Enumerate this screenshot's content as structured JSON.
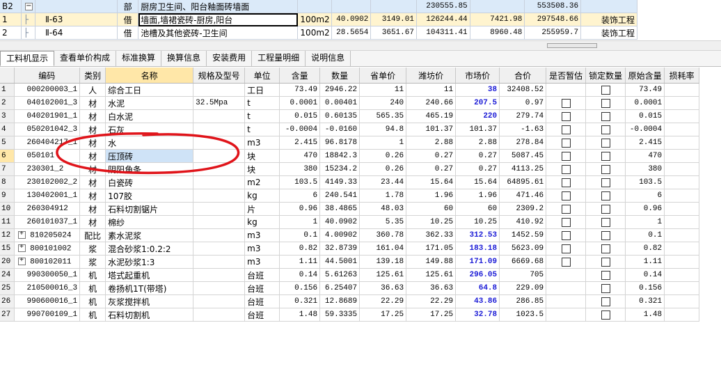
{
  "top_grid": {
    "rows": [
      {
        "no": "B2",
        "expander": "−",
        "code": "",
        "type": "部",
        "name": "厨房卫生间、阳台釉面砖墙面",
        "unit": "",
        "qty": "",
        "price": "",
        "total": "230555.85",
        "c1": "",
        "c2": "553508.36",
        "prof": ""
      },
      {
        "no": "1",
        "expander": "",
        "code": "Ⅱ-63",
        "type": "借",
        "name": "墙面,墙裙瓷砖-厨房,阳台",
        "unit": "100m2",
        "qty": "40.0902",
        "price": "3149.01",
        "total": "126244.44",
        "c1": "7421.98",
        "c2": "297548.66",
        "prof": "装饰工程"
      },
      {
        "no": "2",
        "expander": "",
        "code": "Ⅱ-64",
        "type": "借",
        "name": "池槽及其他瓷砖-卫生间",
        "unit": "100m2",
        "qty": "28.5654",
        "price": "3651.67",
        "total": "104311.41",
        "c1": "8960.48",
        "c2": "255959.7",
        "prof": "装饰工程"
      }
    ]
  },
  "tabs": [
    "工料机显示",
    "查看单价构成",
    "标准换算",
    "换算信息",
    "安装费用",
    "工程量明细",
    "说明信息"
  ],
  "columns": [
    "编码",
    "类别",
    "名称",
    "规格及型号",
    "单位",
    "含量",
    "数量",
    "省单价",
    "潍坊价",
    "市场价",
    "合价",
    "是否暂估",
    "锁定数量",
    "原始含量",
    "损耗率"
  ],
  "rows": [
    {
      "no": "1",
      "plus": false,
      "code": "000200003_1",
      "type": "人",
      "name": "综合工日",
      "spec": "",
      "unit": "工日",
      "content": "73.49",
      "qty": "2946.22",
      "prov": "11",
      "wf": "11",
      "market": "38",
      "total": "32408.52",
      "est": false,
      "lock": true,
      "orig": "73.49"
    },
    {
      "no": "2",
      "plus": false,
      "code": "040102001_3",
      "type": "材",
      "name": "水泥",
      "spec": "32.5Mpa",
      "unit": "t",
      "content": "0.0001",
      "qty": "0.00401",
      "prov": "240",
      "wf": "240.66",
      "market": "207.5",
      "total": "0.97",
      "est": true,
      "lock": true,
      "orig": "0.0001"
    },
    {
      "no": "3",
      "plus": false,
      "code": "040201901_1",
      "type": "材",
      "name": "白水泥",
      "spec": "",
      "unit": "t",
      "content": "0.015",
      "qty": "0.60135",
      "prov": "565.35",
      "wf": "465.19",
      "market": "220",
      "total": "279.74",
      "est": true,
      "lock": true,
      "orig": "0.015"
    },
    {
      "no": "4",
      "plus": false,
      "code": "050201042_3",
      "type": "材",
      "name": "石灰",
      "spec": "",
      "unit": "t",
      "content": "-0.0004",
      "qty": "-0.0160",
      "prov": "94.8",
      "wf": "101.37",
      "market": "101.37",
      "total": "-1.63",
      "est": true,
      "lock": true,
      "orig": "-0.0004"
    },
    {
      "no": "5",
      "plus": false,
      "code": "260404217_1",
      "type": "材",
      "name": "水",
      "spec": "",
      "unit": "m3",
      "content": "2.415",
      "qty": "96.8178",
      "prov": "1",
      "wf": "2.88",
      "market": "2.88",
      "total": "278.84",
      "est": true,
      "lock": true,
      "orig": "2.415"
    },
    {
      "no": "6",
      "plus": false,
      "code": "050101",
      "type": "材",
      "name": "压顶砖",
      "spec": "",
      "unit": "块",
      "content": "470",
      "qty": "18842.3",
      "prov": "0.26",
      "wf": "0.27",
      "market": "0.27",
      "total": "5087.45",
      "est": true,
      "lock": true,
      "orig": "470"
    },
    {
      "no": "7",
      "plus": false,
      "code": "230301_2",
      "type": "材",
      "name": "阴阳角条",
      "spec": "",
      "unit": "块",
      "content": "380",
      "qty": "15234.2",
      "prov": "0.26",
      "wf": "0.27",
      "market": "0.27",
      "total": "4113.25",
      "est": true,
      "lock": true,
      "orig": "380"
    },
    {
      "no": "8",
      "plus": false,
      "code": "230102002_2",
      "type": "材",
      "name": "白瓷砖",
      "spec": "",
      "unit": "m2",
      "content": "103.5",
      "qty": "4149.33",
      "prov": "23.44",
      "wf": "15.64",
      "market": "15.64",
      "total": "64895.61",
      "est": true,
      "lock": true,
      "orig": "103.5"
    },
    {
      "no": "9",
      "plus": false,
      "code": "130402001_1",
      "type": "材",
      "name": "107胶",
      "spec": "",
      "unit": "kg",
      "content": "6",
      "qty": "240.541",
      "prov": "1.78",
      "wf": "1.96",
      "market": "1.96",
      "total": "471.46",
      "est": true,
      "lock": true,
      "orig": "6"
    },
    {
      "no": "10",
      "plus": false,
      "code": "260304912",
      "type": "材",
      "name": "石料切割锯片",
      "spec": "",
      "unit": "片",
      "content": "0.96",
      "qty": "38.4865",
      "prov": "48.03",
      "wf": "60",
      "market": "60",
      "total": "2309.2",
      "est": true,
      "lock": true,
      "orig": "0.96"
    },
    {
      "no": "11",
      "plus": false,
      "code": "260101037_1",
      "type": "材",
      "name": "棉纱",
      "spec": "",
      "unit": "kg",
      "content": "1",
      "qty": "40.0902",
      "prov": "5.35",
      "wf": "10.25",
      "market": "10.25",
      "total": "410.92",
      "est": true,
      "lock": true,
      "orig": "1"
    },
    {
      "no": "12",
      "plus": true,
      "code": "810205024",
      "type": "配比",
      "name": "素水泥浆",
      "spec": "",
      "unit": "m3",
      "content": "0.1",
      "qty": "4.00902",
      "prov": "360.78",
      "wf": "362.33",
      "market": "312.53",
      "total": "1452.59",
      "est": true,
      "lock": true,
      "orig": "0.1"
    },
    {
      "no": "15",
      "plus": true,
      "code": "800101002",
      "type": "浆",
      "name": "混合砂浆1:0.2:2",
      "spec": "",
      "unit": "m3",
      "content": "0.82",
      "qty": "32.8739",
      "prov": "161.04",
      "wf": "171.05",
      "market": "183.18",
      "total": "5623.09",
      "est": true,
      "lock": true,
      "orig": "0.82"
    },
    {
      "no": "20",
      "plus": true,
      "code": "800102011",
      "type": "浆",
      "name": "水泥砂浆1:3",
      "spec": "",
      "unit": "m3",
      "content": "1.11",
      "qty": "44.5001",
      "prov": "139.18",
      "wf": "149.88",
      "market": "171.09",
      "total": "6669.68",
      "est": true,
      "lock": true,
      "orig": "1.11"
    },
    {
      "no": "24",
      "plus": false,
      "code": "990300050_1",
      "type": "机",
      "name": "塔式起重机",
      "spec": "",
      "unit": "台班",
      "content": "0.14",
      "qty": "5.61263",
      "prov": "125.61",
      "wf": "125.61",
      "market": "296.05",
      "total": "705",
      "est": false,
      "lock": true,
      "orig": "0.14"
    },
    {
      "no": "25",
      "plus": false,
      "code": "210500016_3",
      "type": "机",
      "name": "卷扬机1T(带塔)",
      "spec": "",
      "unit": "台班",
      "content": "0.156",
      "qty": "6.25407",
      "prov": "36.63",
      "wf": "36.63",
      "market": "64.8",
      "total": "229.09",
      "est": false,
      "lock": true,
      "orig": "0.156"
    },
    {
      "no": "26",
      "plus": false,
      "code": "990600016_1",
      "type": "机",
      "name": "灰浆搅拌机",
      "spec": "",
      "unit": "台班",
      "content": "0.321",
      "qty": "12.8689",
      "prov": "22.29",
      "wf": "22.29",
      "market": "43.86",
      "total": "286.85",
      "est": false,
      "lock": true,
      "orig": "0.321"
    },
    {
      "no": "27",
      "plus": false,
      "code": "990700109_1",
      "type": "机",
      "name": "石料切割机",
      "spec": "",
      "unit": "台班",
      "content": "1.48",
      "qty": "59.3335",
      "prov": "17.25",
      "wf": "17.25",
      "market": "32.78",
      "total": "1023.5",
      "est": false,
      "lock": true,
      "orig": "1.48"
    }
  ],
  "colors": {
    "market_value": "#1c1cd6",
    "annotation": "#e0141a",
    "selected_header": "#ffe7a8"
  }
}
